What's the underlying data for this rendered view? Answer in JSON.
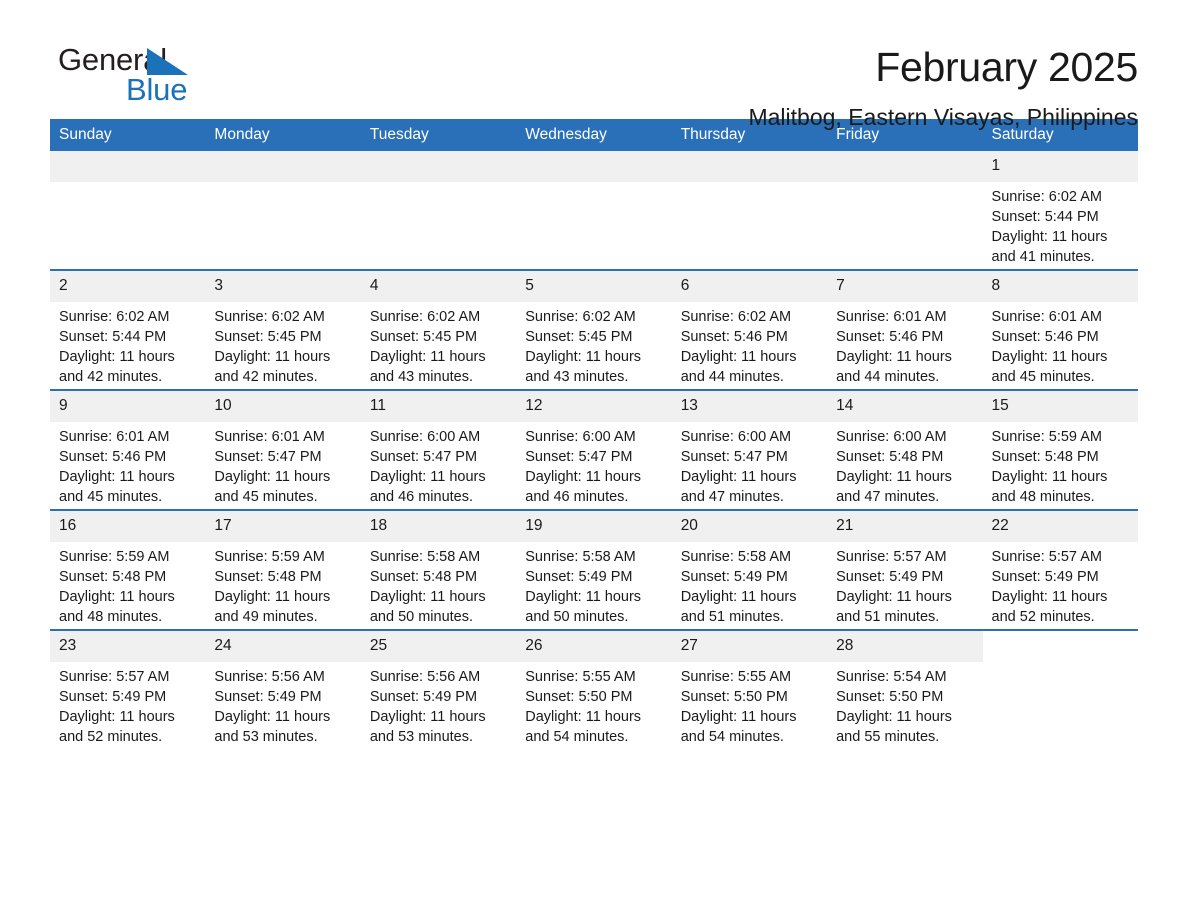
{
  "brand": {
    "name_part1": "General",
    "name_part2": "Blue"
  },
  "header": {
    "month_title": "February 2025",
    "location": "Malitbog, Eastern Visayas, Philippines"
  },
  "colors": {
    "header_blue": "#2a70b8",
    "logo_blue": "#1b72b8",
    "daynum_band": "#f0f0f0",
    "text": "#1a1a1a"
  },
  "weekday_headers": [
    "Sunday",
    "Monday",
    "Tuesday",
    "Wednesday",
    "Thursday",
    "Friday",
    "Saturday"
  ],
  "labels": {
    "sunrise_prefix": "Sunrise: ",
    "sunset_prefix": "Sunset: ",
    "daylight_prefix": "Daylight: "
  },
  "weeks": [
    [
      {
        "type": "empty"
      },
      {
        "type": "empty"
      },
      {
        "type": "empty"
      },
      {
        "type": "empty"
      },
      {
        "type": "empty"
      },
      {
        "type": "empty"
      },
      {
        "type": "day",
        "date": "1",
        "sunrise": "Sunrise: 6:02 AM",
        "sunset": "Sunset: 5:44 PM",
        "daylight": "Daylight: 11 hours and 41 minutes."
      }
    ],
    [
      {
        "type": "day",
        "date": "2",
        "sunrise": "Sunrise: 6:02 AM",
        "sunset": "Sunset: 5:44 PM",
        "daylight": "Daylight: 11 hours and 42 minutes."
      },
      {
        "type": "day",
        "date": "3",
        "sunrise": "Sunrise: 6:02 AM",
        "sunset": "Sunset: 5:45 PM",
        "daylight": "Daylight: 11 hours and 42 minutes."
      },
      {
        "type": "day",
        "date": "4",
        "sunrise": "Sunrise: 6:02 AM",
        "sunset": "Sunset: 5:45 PM",
        "daylight": "Daylight: 11 hours and 43 minutes."
      },
      {
        "type": "day",
        "date": "5",
        "sunrise": "Sunrise: 6:02 AM",
        "sunset": "Sunset: 5:45 PM",
        "daylight": "Daylight: 11 hours and 43 minutes."
      },
      {
        "type": "day",
        "date": "6",
        "sunrise": "Sunrise: 6:02 AM",
        "sunset": "Sunset: 5:46 PM",
        "daylight": "Daylight: 11 hours and 44 minutes."
      },
      {
        "type": "day",
        "date": "7",
        "sunrise": "Sunrise: 6:01 AM",
        "sunset": "Sunset: 5:46 PM",
        "daylight": "Daylight: 11 hours and 44 minutes."
      },
      {
        "type": "day",
        "date": "8",
        "sunrise": "Sunrise: 6:01 AM",
        "sunset": "Sunset: 5:46 PM",
        "daylight": "Daylight: 11 hours and 45 minutes."
      }
    ],
    [
      {
        "type": "day",
        "date": "9",
        "sunrise": "Sunrise: 6:01 AM",
        "sunset": "Sunset: 5:46 PM",
        "daylight": "Daylight: 11 hours and 45 minutes."
      },
      {
        "type": "day",
        "date": "10",
        "sunrise": "Sunrise: 6:01 AM",
        "sunset": "Sunset: 5:47 PM",
        "daylight": "Daylight: 11 hours and 45 minutes."
      },
      {
        "type": "day",
        "date": "11",
        "sunrise": "Sunrise: 6:00 AM",
        "sunset": "Sunset: 5:47 PM",
        "daylight": "Daylight: 11 hours and 46 minutes."
      },
      {
        "type": "day",
        "date": "12",
        "sunrise": "Sunrise: 6:00 AM",
        "sunset": "Sunset: 5:47 PM",
        "daylight": "Daylight: 11 hours and 46 minutes."
      },
      {
        "type": "day",
        "date": "13",
        "sunrise": "Sunrise: 6:00 AM",
        "sunset": "Sunset: 5:47 PM",
        "daylight": "Daylight: 11 hours and 47 minutes."
      },
      {
        "type": "day",
        "date": "14",
        "sunrise": "Sunrise: 6:00 AM",
        "sunset": "Sunset: 5:48 PM",
        "daylight": "Daylight: 11 hours and 47 minutes."
      },
      {
        "type": "day",
        "date": "15",
        "sunrise": "Sunrise: 5:59 AM",
        "sunset": "Sunset: 5:48 PM",
        "daylight": "Daylight: 11 hours and 48 minutes."
      }
    ],
    [
      {
        "type": "day",
        "date": "16",
        "sunrise": "Sunrise: 5:59 AM",
        "sunset": "Sunset: 5:48 PM",
        "daylight": "Daylight: 11 hours and 48 minutes."
      },
      {
        "type": "day",
        "date": "17",
        "sunrise": "Sunrise: 5:59 AM",
        "sunset": "Sunset: 5:48 PM",
        "daylight": "Daylight: 11 hours and 49 minutes."
      },
      {
        "type": "day",
        "date": "18",
        "sunrise": "Sunrise: 5:58 AM",
        "sunset": "Sunset: 5:48 PM",
        "daylight": "Daylight: 11 hours and 50 minutes."
      },
      {
        "type": "day",
        "date": "19",
        "sunrise": "Sunrise: 5:58 AM",
        "sunset": "Sunset: 5:49 PM",
        "daylight": "Daylight: 11 hours and 50 minutes."
      },
      {
        "type": "day",
        "date": "20",
        "sunrise": "Sunrise: 5:58 AM",
        "sunset": "Sunset: 5:49 PM",
        "daylight": "Daylight: 11 hours and 51 minutes."
      },
      {
        "type": "day",
        "date": "21",
        "sunrise": "Sunrise: 5:57 AM",
        "sunset": "Sunset: 5:49 PM",
        "daylight": "Daylight: 11 hours and 51 minutes."
      },
      {
        "type": "day",
        "date": "22",
        "sunrise": "Sunrise: 5:57 AM",
        "sunset": "Sunset: 5:49 PM",
        "daylight": "Daylight: 11 hours and 52 minutes."
      }
    ],
    [
      {
        "type": "day",
        "date": "23",
        "sunrise": "Sunrise: 5:57 AM",
        "sunset": "Sunset: 5:49 PM",
        "daylight": "Daylight: 11 hours and 52 minutes."
      },
      {
        "type": "day",
        "date": "24",
        "sunrise": "Sunrise: 5:56 AM",
        "sunset": "Sunset: 5:49 PM",
        "daylight": "Daylight: 11 hours and 53 minutes."
      },
      {
        "type": "day",
        "date": "25",
        "sunrise": "Sunrise: 5:56 AM",
        "sunset": "Sunset: 5:49 PM",
        "daylight": "Daylight: 11 hours and 53 minutes."
      },
      {
        "type": "day",
        "date": "26",
        "sunrise": "Sunrise: 5:55 AM",
        "sunset": "Sunset: 5:50 PM",
        "daylight": "Daylight: 11 hours and 54 minutes."
      },
      {
        "type": "day",
        "date": "27",
        "sunrise": "Sunrise: 5:55 AM",
        "sunset": "Sunset: 5:50 PM",
        "daylight": "Daylight: 11 hours and 54 minutes."
      },
      {
        "type": "day",
        "date": "28",
        "sunrise": "Sunrise: 5:54 AM",
        "sunset": "Sunset: 5:50 PM",
        "daylight": "Daylight: 11 hours and 55 minutes."
      },
      {
        "type": "blank"
      }
    ]
  ]
}
